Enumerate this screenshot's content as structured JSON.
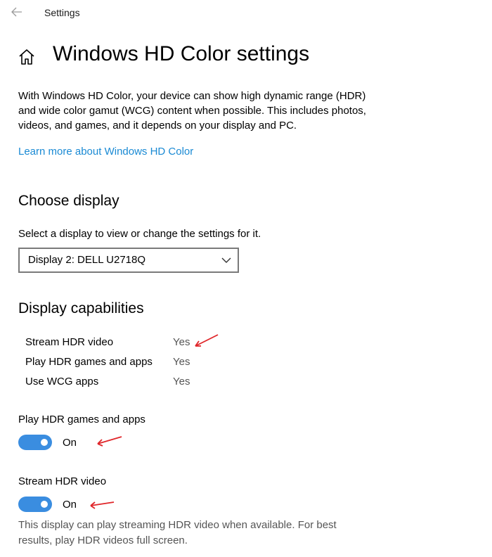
{
  "window": {
    "app_title": "Settings"
  },
  "header": {
    "page_title": "Windows HD Color settings"
  },
  "intro": {
    "description": "With Windows HD Color, your device can show high dynamic range (HDR) and wide color gamut (WCG) content when possible. This includes photos, videos, and games, and it depends on your display and PC.",
    "learn_more_link": "Learn more about Windows HD Color"
  },
  "choose_display": {
    "heading": "Choose display",
    "label": "Select a display to view or change the settings for it.",
    "selected": "Display 2: DELL U2718Q"
  },
  "capabilities": {
    "heading": "Display capabilities",
    "rows": [
      {
        "name": "Stream HDR video",
        "value": "Yes"
      },
      {
        "name": "Play HDR games and apps",
        "value": "Yes"
      },
      {
        "name": "Use WCG apps",
        "value": "Yes"
      }
    ]
  },
  "hdr_games": {
    "label": "Play HDR games and apps",
    "state": "On"
  },
  "hdr_video": {
    "label": "Stream HDR video",
    "state": "On",
    "note": "This display can play streaming HDR video when available. For best results, play HDR videos full screen."
  },
  "colors": {
    "accent": "#3a8de0",
    "link": "#1a8ad4",
    "annotation_arrow": "#e0262a"
  }
}
